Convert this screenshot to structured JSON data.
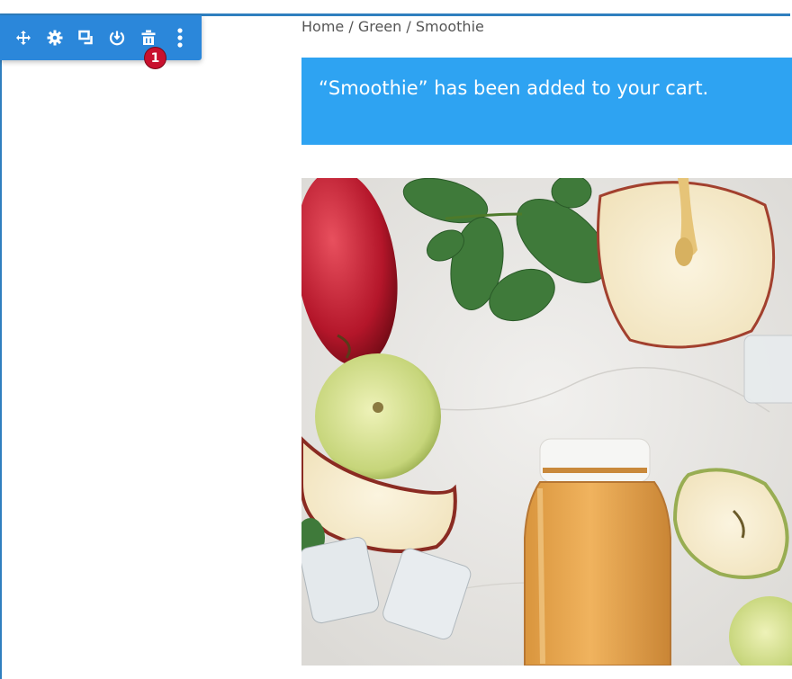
{
  "toolbar": {
    "color": "#2b87da",
    "buttons": [
      {
        "name": "move",
        "icon": "move-icon"
      },
      {
        "name": "settings",
        "icon": "gear-icon"
      },
      {
        "name": "duplicate",
        "icon": "duplicate-icon"
      },
      {
        "name": "save-to-library",
        "icon": "power-save-icon"
      },
      {
        "name": "delete",
        "icon": "trash-icon"
      },
      {
        "name": "more",
        "icon": "more-vertical-icon"
      }
    ],
    "badge_count": "1"
  },
  "breadcrumb": {
    "items": [
      "Home",
      "Green",
      "Smoothie"
    ],
    "separator": " / "
  },
  "notice": {
    "message": "“Smoothie” has been added to your cart.",
    "background": "#2ea3f2"
  },
  "product_image": {
    "subject": "apple juice bottle with apples, mint leaves and ice cubes"
  }
}
